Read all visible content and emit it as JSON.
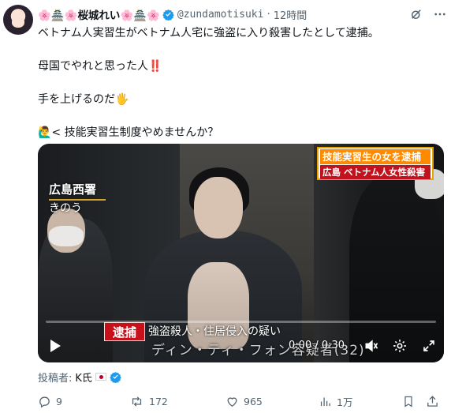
{
  "author": {
    "display_name_prefix": "🌸🏯🌸",
    "display_name": "桜城れい",
    "display_name_suffix": "🌸🏯🌸",
    "handle": "@zundamotisuki",
    "separator": "·",
    "time": "12時間"
  },
  "post": {
    "lines": [
      "ベトナム人実習生がベトナム人宅に強盗に入り殺害したとして逮捕。",
      "母国でやれと思った人‼️",
      "手を上げるのだ🖐",
      "🙋‍♂️< 技能実習生制度やめませんか？"
    ]
  },
  "video": {
    "location_title": "広島西署",
    "location_sub": "きのう",
    "news_headline_1": "技能実習生の女を逮捕",
    "news_headline_2": "広島 ベトナム人女性殺害",
    "arrest_tag": "逮捕",
    "caption_charge": "強盗殺人・住居侵入の疑い",
    "caption_name": "ディン・ティ・フォン容疑者(32)",
    "timecode": "0:00 / 0:30",
    "progress": 0
  },
  "poster": {
    "label": "投稿者:",
    "name": "K氏"
  },
  "actions": {
    "replies": "9",
    "reposts": "172",
    "likes": "965",
    "views": "1万"
  },
  "colors": {
    "text": "#0f1419",
    "muted": "#536471",
    "verified": "#1d9bf0",
    "news_orange": "#ff8a00",
    "news_red": "#c2121d"
  },
  "icons": {
    "verified": "verified-badge-icon",
    "grok": "grok-icon",
    "more": "more-icon",
    "play": "play-icon",
    "volume": "volume-icon",
    "settings": "gear-icon",
    "fullscreen": "fullscreen-icon",
    "reply": "reply-icon",
    "repost": "repost-icon",
    "like": "heart-icon",
    "views": "views-icon"
  }
}
